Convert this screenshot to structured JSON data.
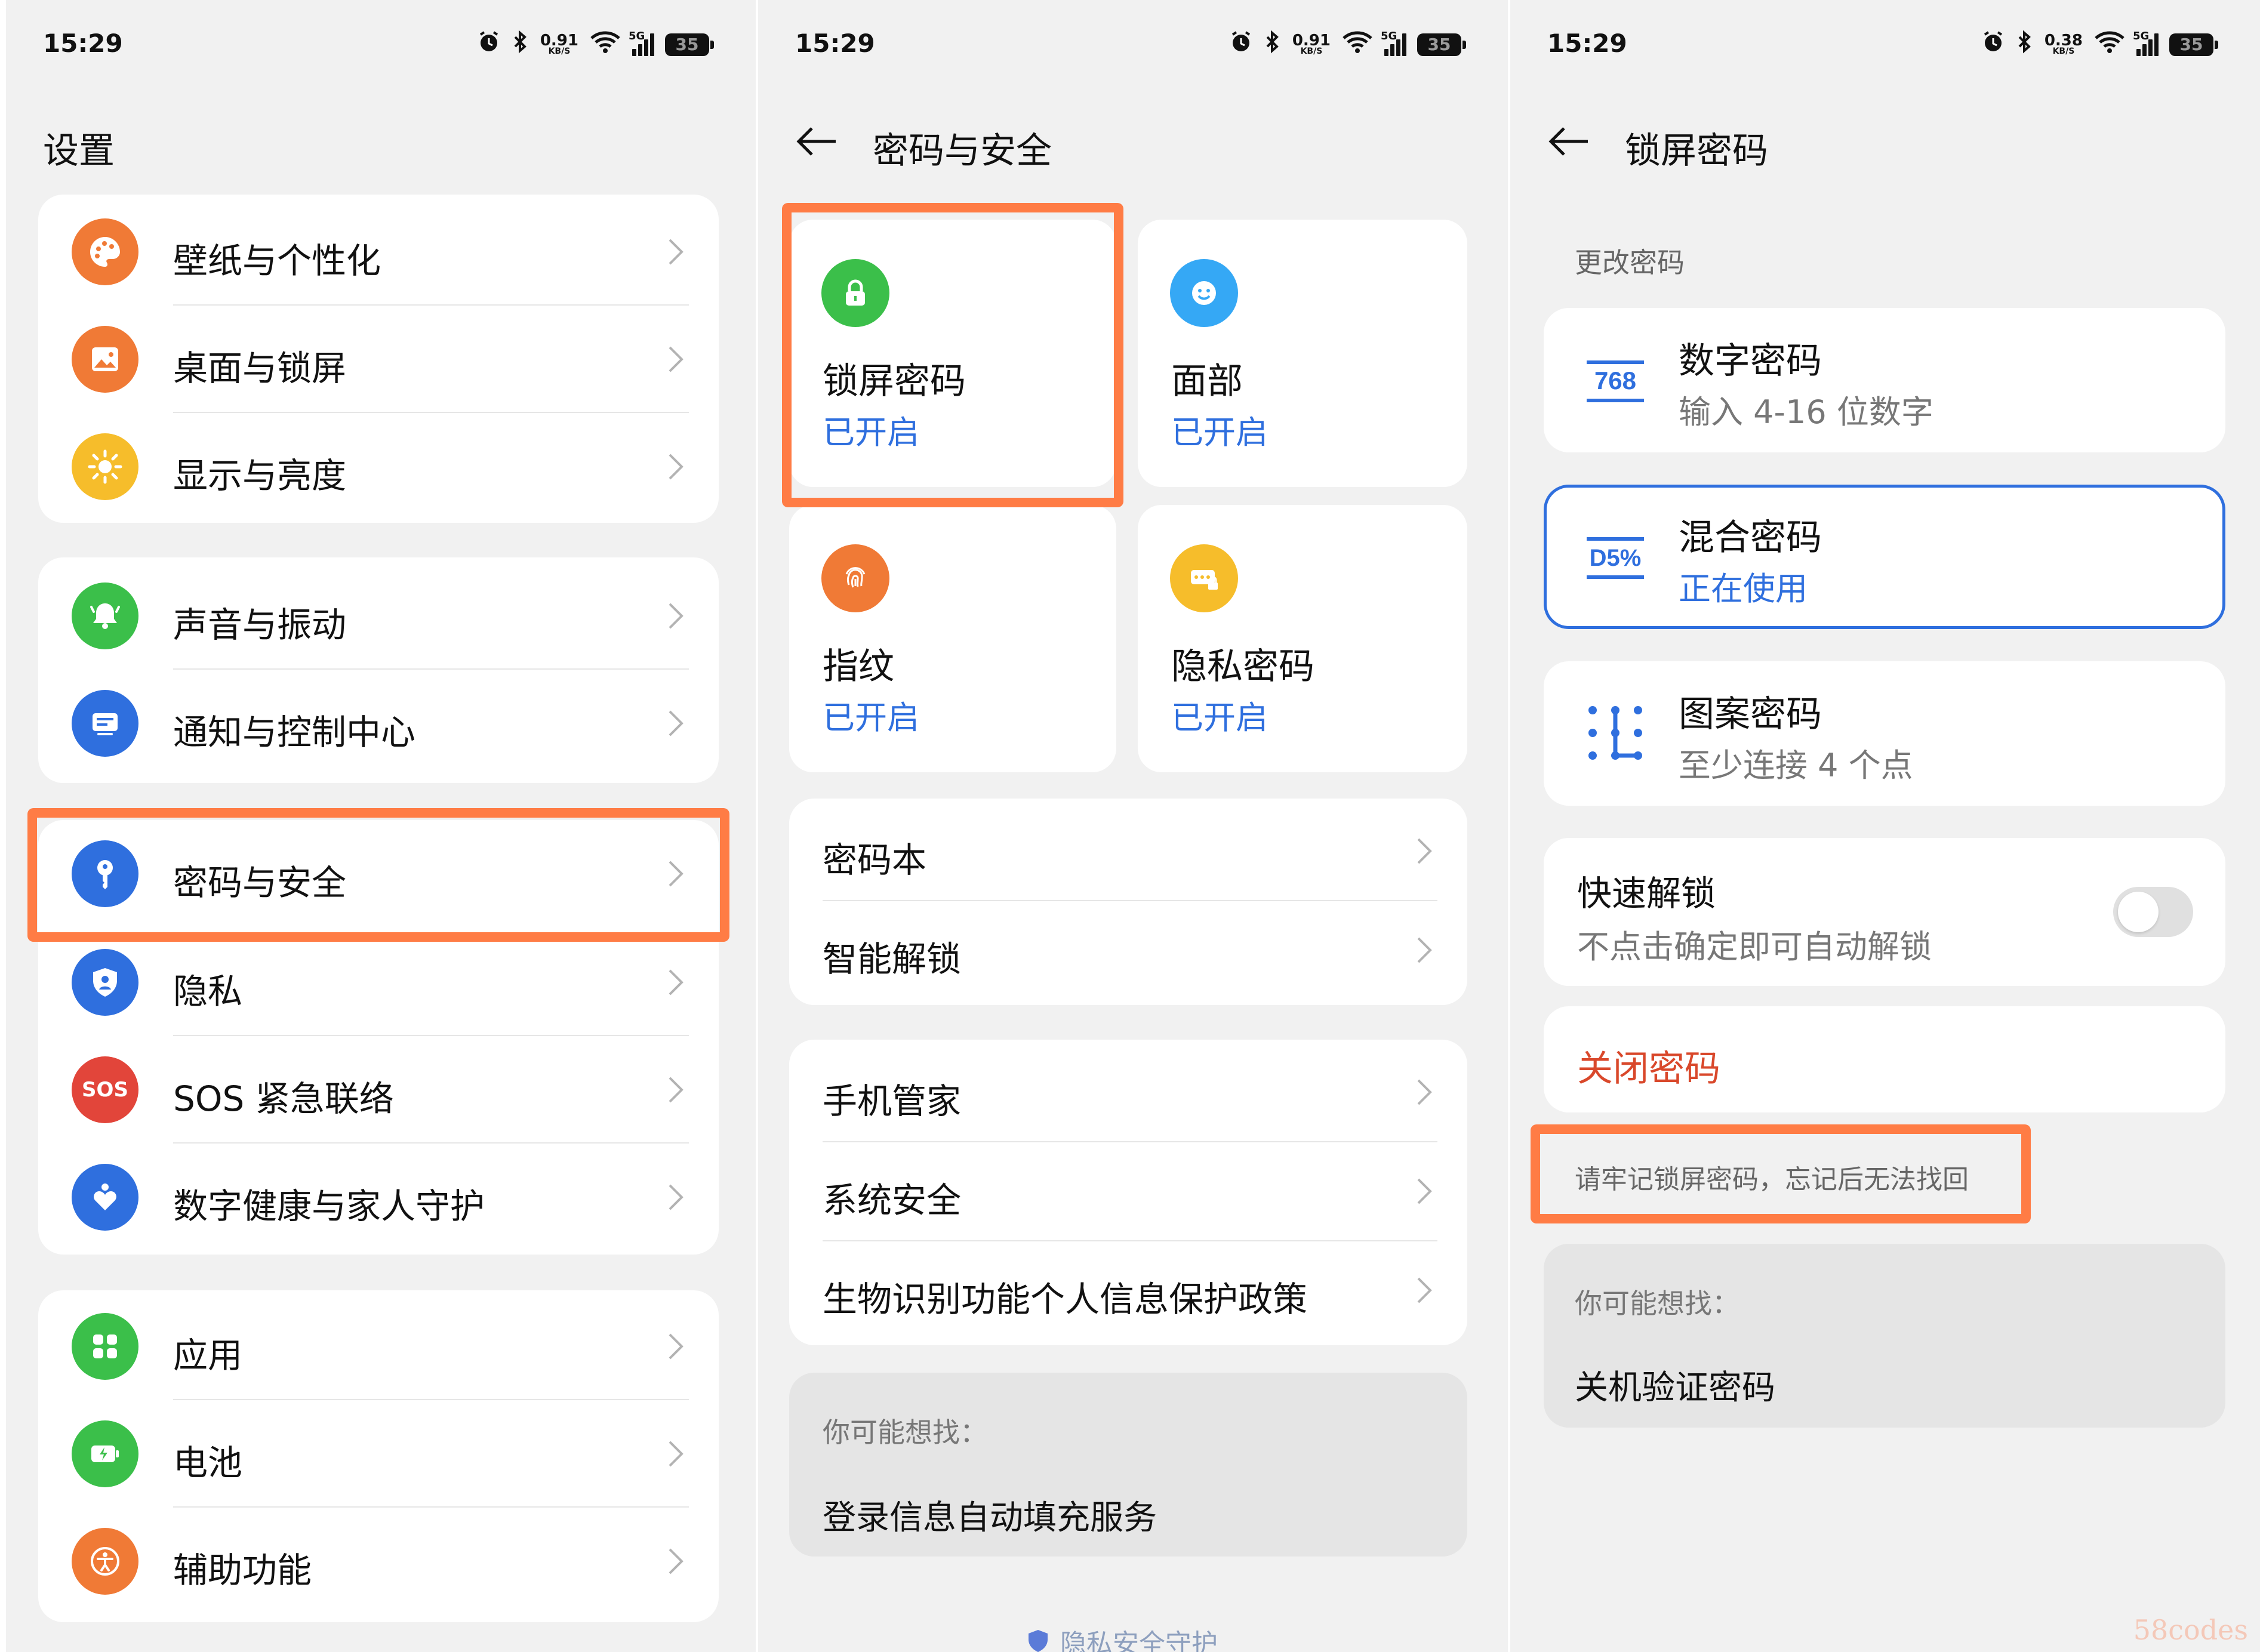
{
  "status": {
    "time": "15:29",
    "speeds": [
      "0.91",
      "0.91",
      "0.38"
    ],
    "speed_unit": "KB/S",
    "network": "5G",
    "battery": "35"
  },
  "panel1": {
    "title": "设置",
    "groups": [
      [
        {
          "label": "壁纸与个性化",
          "icon": "palette-icon",
          "color": "#f07a36"
        },
        {
          "label": "桌面与锁屏",
          "icon": "picture-icon",
          "color": "#f07a36"
        },
        {
          "label": "显示与亮度",
          "icon": "sun-icon",
          "color": "#f6bd2b"
        }
      ],
      [
        {
          "label": "声音与振动",
          "icon": "bell-icon",
          "color": "#3bbf4a"
        },
        {
          "label": "通知与控制中心",
          "icon": "notification-icon",
          "color": "#2f6fde"
        }
      ],
      [
        {
          "label": "密码与安全",
          "icon": "key-icon",
          "color": "#2f6fde"
        },
        {
          "label": "隐私",
          "icon": "shield-icon",
          "color": "#2f6fde"
        },
        {
          "label": "SOS 紧急联络",
          "icon": "sos-icon",
          "color": "#e2453a",
          "icon_text": "SOS"
        },
        {
          "label": "数字健康与家人守护",
          "icon": "heart-icon",
          "color": "#2f6fde"
        }
      ],
      [
        {
          "label": "应用",
          "icon": "apps-grid-icon",
          "color": "#3bbf4a"
        },
        {
          "label": "电池",
          "icon": "battery-icon",
          "color": "#3bbf4a"
        },
        {
          "label": "辅助功能",
          "icon": "accessibility-icon",
          "color": "#f07a36"
        }
      ]
    ]
  },
  "panel2": {
    "title": "密码与安全",
    "tiles": [
      {
        "name": "锁屏密码",
        "status": "已开启",
        "icon": "lock-icon",
        "color": "#3bbf4a"
      },
      {
        "name": "面部",
        "status": "已开启",
        "icon": "face-icon",
        "color": "#35a8f5"
      },
      {
        "name": "指纹",
        "status": "已开启",
        "icon": "fingerprint-icon",
        "color": "#f07a36"
      },
      {
        "name": "隐私密码",
        "status": "已开启",
        "icon": "privacy-password-icon",
        "color": "#f6bd2b"
      }
    ],
    "group1": [
      "密码本",
      "智能解锁"
    ],
    "group2": [
      "手机管家",
      "系统安全",
      "生物识别功能个人信息保护政策"
    ],
    "hint_title": "你可能想找：",
    "hint_link": "登录信息自动填充服务",
    "footer": "隐私安全守护"
  },
  "panel3": {
    "title": "锁屏密码",
    "section": "更改密码",
    "options": [
      {
        "name": "数字密码",
        "sub": "输入 4-16 位数字",
        "glyph": "768",
        "icon": "numeric-password-icon"
      },
      {
        "name": "混合密码",
        "sub": "正在使用",
        "glyph": "D5%",
        "icon": "mixed-password-icon"
      },
      {
        "name": "图案密码",
        "sub": "至少连接 4 个点",
        "glyph": "",
        "icon": "pattern-password-icon"
      }
    ],
    "quick_unlock": {
      "title": "快速解锁",
      "sub": "不点击确定即可自动解锁",
      "enabled": false
    },
    "close_password": "关闭密码",
    "warning": "请牢记锁屏密码，忘记后无法找回",
    "hint_title": "你可能想找：",
    "hint_link": "关机验证密码"
  },
  "watermark": "58codes",
  "colors": {
    "accent": "#2f6fde",
    "highlight": "#ff7c45",
    "danger": "#d9482b"
  }
}
